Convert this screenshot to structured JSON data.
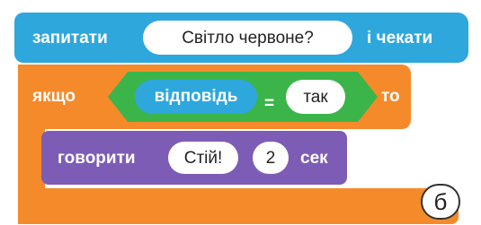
{
  "ask_block": {
    "label": "запитати",
    "question": "Світло  червоне?",
    "wait_label": "і чекати"
  },
  "if_block": {
    "if_label": "якщо",
    "then_label": "то",
    "condition": {
      "left": "відповідь",
      "operator": "=",
      "right": "так"
    }
  },
  "say_block": {
    "label": "говорити",
    "message": "Стій!",
    "seconds": "2",
    "unit": "сек"
  },
  "figure_letter": "б",
  "colors": {
    "ask": "#2ea7dd",
    "control": "#f58a2a",
    "operator": "#3bb54a",
    "looks": "#7d5cb5"
  }
}
